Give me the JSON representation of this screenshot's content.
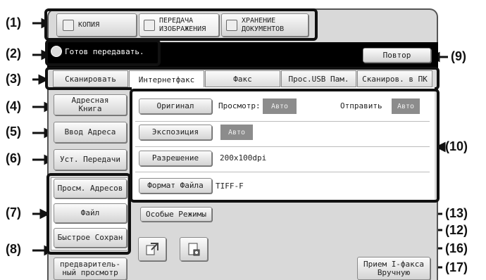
{
  "callouts": [
    "(1)",
    "(2)",
    "(3)",
    "(4)",
    "(5)",
    "(6)",
    "(7)",
    "(8)",
    "(9)",
    "(10)",
    "(13)",
    "(12)",
    "(16)",
    "(17)"
  ],
  "modes": {
    "copy": "КОПИЯ",
    "image_send_1": "ПЕРЕДАЧА",
    "image_send_2": "ИЗОБРАЖЕНИЯ",
    "doc_store_1": "ХРАНЕНИЕ",
    "doc_store_2": "ДОКУМЕНТОВ"
  },
  "status": {
    "message": "Готов передавать.",
    "repeat_label": "Повтор"
  },
  "tabs": [
    "Сканировать",
    "Интернетфакс",
    "Факс",
    "Прос.USB Пам.",
    "Сканиров. в ПК"
  ],
  "side": {
    "address_book_1": "Адресная",
    "address_book_2": "Книга",
    "address_entry": "Ввод Адреса",
    "send_settings": "Уст. Передачи",
    "view_addresses": "Просм. Адресов",
    "file": "Файл",
    "quick_file": "Быстрое Сохран",
    "preview_1": "предваритель-",
    "preview_2": "ный просмотр"
  },
  "settings": {
    "original_label": "Оригинал",
    "preview_label": "Просмотр:",
    "preview_value": "Авто",
    "send_label": "Отправить",
    "send_value": "Авто",
    "exposure_label": "Экспозиция",
    "exposure_value": "Авто",
    "resolution_label": "Разрешение",
    "resolution_value": "200x100dpi",
    "format_label": "Формат Файла",
    "format_value": "TIFF-F"
  },
  "special_modes_label": "Особые Режимы",
  "manual_reception_1": "Прием I-факса",
  "manual_reception_2": "Вручную",
  "icons": [
    "copy-icon",
    "image-send-icon",
    "document-filing-icon",
    "status-mode-icon",
    "address-direct-icon",
    "sending-settings-icon"
  ]
}
